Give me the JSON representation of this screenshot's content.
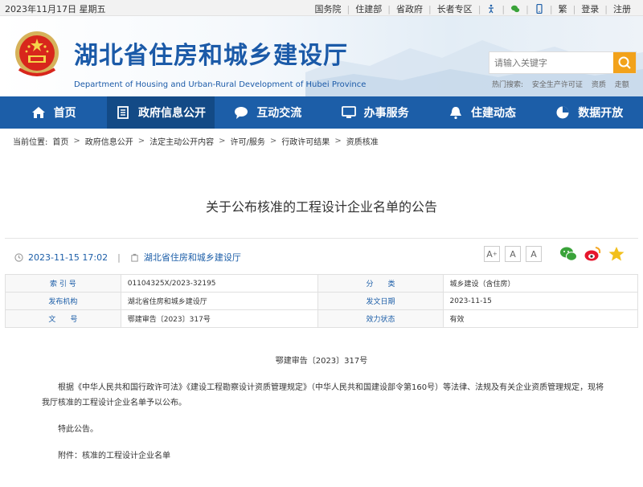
{
  "topbar": {
    "date": "2023年11月17日 星期五",
    "links": [
      "国务院",
      "住建部",
      "省政府",
      "长者专区"
    ],
    "links2": [
      "繁",
      "登录",
      "注册"
    ]
  },
  "header": {
    "title_cn": "湖北省住房和城乡建设厅",
    "title_en": "Department of Housing and Urban-Rural Development of Hubei Province",
    "search_placeholder": "请输入关键字",
    "hot_label": "热门搜索:",
    "hot_items": [
      "安全生产许可证",
      "资质",
      "走额"
    ]
  },
  "nav": [
    {
      "label": "首页",
      "icon": "home-icon"
    },
    {
      "label": "政府信息公开",
      "icon": "document-icon"
    },
    {
      "label": "互动交流",
      "icon": "chat-icon"
    },
    {
      "label": "办事服务",
      "icon": "monitor-icon"
    },
    {
      "label": "住建动态",
      "icon": "bell-icon"
    },
    {
      "label": "数据开放",
      "icon": "pie-chart-icon"
    }
  ],
  "breadcrumb": {
    "label": "当前位置:",
    "items": [
      "首页",
      "政府信息公开",
      "法定主动公开内容",
      "许可/服务",
      "行政许可结果",
      "资质核准"
    ]
  },
  "article": {
    "title": "关于公布核准的工程设计企业名单的公告",
    "datetime": "2023-11-15 17:02",
    "publisher": "湖北省住房和城乡建设厅",
    "font_buttons": [
      "A",
      "A",
      "A"
    ]
  },
  "info_table": {
    "rows": [
      {
        "l1": "索 引 号",
        "v1": "01104325X/2023-32195",
        "l2": "分　　类",
        "v2": "城乡建设（含住房）"
      },
      {
        "l1": "发布机构",
        "v1": "湖北省住房和城乡建设厅",
        "l2": "发文日期",
        "v2": "2023-11-15"
      },
      {
        "l1": "文　　号",
        "v1": "鄂建审告〔2023〕317号",
        "l2": "效力状态",
        "v2": "有效"
      }
    ]
  },
  "body": {
    "doc_number": "鄂建审告〔2023〕317号",
    "paragraph1": "根据《中华人民共和国行政许可法》《建设工程勘察设计资质管理规定》（中华人民共和国建设部令第160号）等法律、法规及有关企业资质管理规定，现将我厅核准的工程设计企业名单予以公布。",
    "paragraph2": "特此公告。",
    "paragraph3": "附件：核准的工程设计企业名单"
  },
  "colors": {
    "brand_blue": "#1c5ea8",
    "nav_active": "#134a86",
    "search_btn": "#f2a21b"
  }
}
